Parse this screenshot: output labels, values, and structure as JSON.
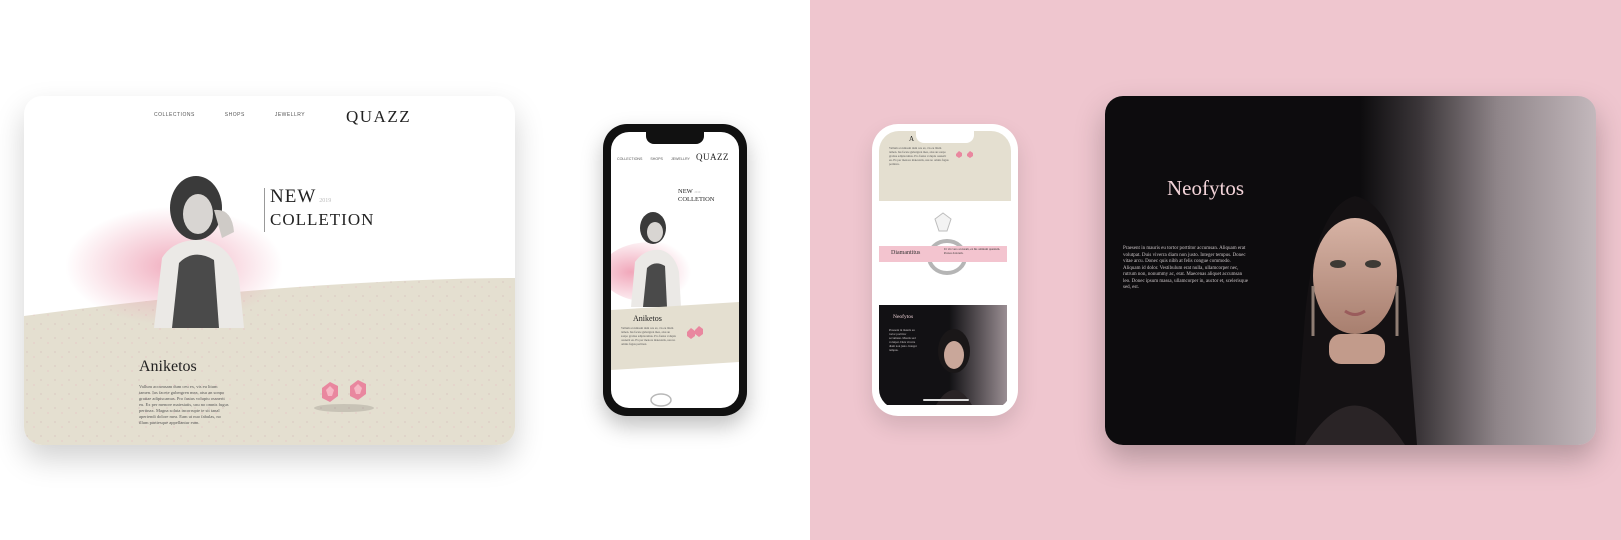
{
  "tablet_left": {
    "nav": [
      "COLLECTIONS",
      "SHOPS",
      "JEWELLRY"
    ],
    "logo": "QUAZZ",
    "hero_line1": "NEW",
    "hero_year": "2019",
    "hero_line2": "COLLETION",
    "product_heading": "Aniketos",
    "product_text": "Vallum accumsam dum ceu ex, vis eu litum tamen. Ius facete gubergren mea, atsu an sonpo gratiae adipiscamus. Pro fastus voluptu ossnerit eu. Ex per menore maiestatis, usu no omnis fugus pertinax. Magna soluta incorrupte te sit tanal aperiendi dolore mea. Eam ut nuo fabulas, no illum parttesque appellantur eum."
  },
  "phone_left": {
    "nav": [
      "COLLECTIONS",
      "SHOPS",
      "JEWELLRY"
    ],
    "logo": "QUAZZ",
    "hero_line1": "NEW",
    "hero_year": "2019",
    "hero_line2": "COLLETION",
    "product_heading": "Aniketos",
    "product_text": "Vallum accumsam dum ceu ex, vis eu litum tamen. Ius facete gubergren mea, atsu an sonpo gratiae adipiscamus. Pro fastus voluptu ossnerit eu. Ex per menore maiestatis, usu no omnis fugus pertinax."
  },
  "phone_right": {
    "top_heading": "A",
    "top_text": "Vallum accumsam dum ceu ex, vis eu litum tamen. Ius facete gubergren mea, atsu an sonpo gratiae adipiscamus. Pro fastus voluptu ossnerit eu. Ex per menore maiestatis, usu no omnis fugus pertinax.",
    "diamond_label": "Diamantitus",
    "diamond_text": "Ut vix vero accusam, ex his omnium quantum. Postea dolorem.",
    "dark_heading": "Neofytos",
    "dark_text": "Praesent in mauris eu tortor porttitor accumsan. Mauris sed volutpat. Duis viverra diam non justo. Integer tempus."
  },
  "tablet_right": {
    "title": "Neofytos",
    "text": "Praesent in mauris eu tortor porttitor accumsan. Aliquam erat volutpat. Duis viverra diam non justo. Integer tempus. Donec vitae arcu. Donec quis nibh at felis congue commodo. Aliquam id dolor. Vestibulum erat nulla, ullamcorper nec, rutrum non, nonummy ac, erat. Maecenas aliquet accumsan leo. Donec ipsum massa, ullamcorper in, auctor et, scelerisque sed, est."
  },
  "colors": {
    "accent_pink": "#efc6cf",
    "sand": "#e4dfd0",
    "dark": "#0d0c0e",
    "title_pink": "#f2d3d8"
  }
}
